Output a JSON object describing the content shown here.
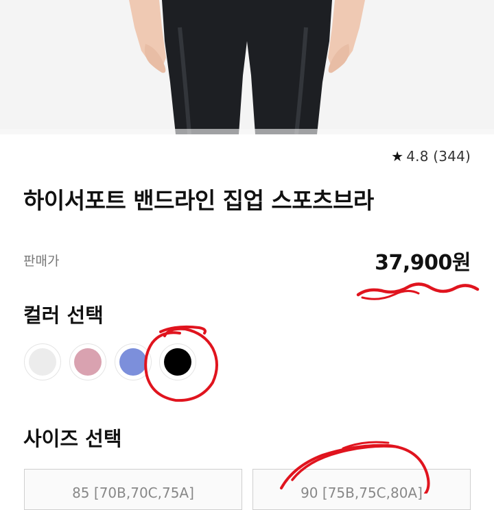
{
  "product": {
    "rating_value": "4.8",
    "review_count": "(344)",
    "title": "하이서포트 밴드라인 집업 스포츠브라",
    "price_label": "판매가",
    "price": "37,900원"
  },
  "color_section": {
    "title": "컬러 선택",
    "swatches": [
      {
        "color": "#ececec"
      },
      {
        "color": "#d9a2b0"
      },
      {
        "color": "#7c8fdb"
      },
      {
        "color": "#000000",
        "selected": true
      }
    ]
  },
  "size_section": {
    "title": "사이즈 선택",
    "options": [
      {
        "label": "85 [70B,70C,75A]"
      },
      {
        "label": "90 [75B,75C,80A]"
      }
    ]
  },
  "colors": {
    "accent_annotation": "#e0141e",
    "hero_background": "#f4f4f4",
    "legging": "#1d1f23",
    "skin": "#efc9b3"
  }
}
